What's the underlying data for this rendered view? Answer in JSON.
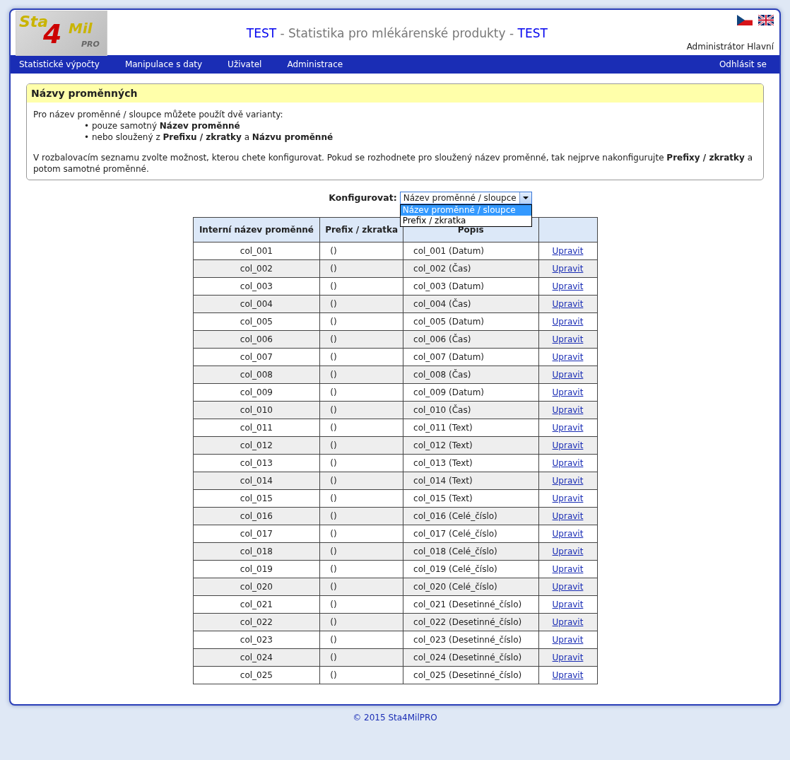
{
  "header": {
    "logo": {
      "parts": [
        "Sta",
        "4",
        "Mil",
        "PRO"
      ]
    },
    "title": {
      "prefix": "TEST",
      "main": " - Statistika pro mlékárenské produkty - ",
      "suffix": "TEST"
    },
    "languages": [
      {
        "kind": "czech"
      },
      {
        "kind": "english"
      }
    ],
    "user": "Administrátor Hlavní"
  },
  "nav": {
    "items": [
      "Statistické výpočty",
      "Manipulace s daty",
      "Uživatel",
      "Administrace"
    ],
    "logout": "Odhlásit se"
  },
  "info_box": {
    "title": "Názvy proměnných",
    "intro": "Pro název proměnné / sloupce můžete použít dvě varianty:",
    "bullets": [
      "• pouze samotný **Název proměnné**",
      "• nebo sloužený z **Prefixu / zkratky** a **Názvu proměnné**"
    ],
    "note": "V rozbalovacím seznamu zvolte možnost, kterou chete konfigurovat. Pokud se rozhodnete pro sloužený název proměnné, tak nejprve nakonfigurujte **Prefixy / zkratky** a potom samotné proměnné."
  },
  "configure": {
    "label": "Konfigurovat:",
    "value": "Název proměnné / sloupce",
    "expanded": true,
    "options": [
      {
        "label": "Název proměnné / sloupce",
        "selected": true
      },
      {
        "label": "Prefix / zkratka",
        "selected": false
      }
    ]
  },
  "table": {
    "columns": [
      "Interní název proměnné",
      "Prefix / zkratka",
      "Popis"
    ],
    "rows": [
      {
        "name": "col_001",
        "prefix": "()",
        "description": "col_001 (Datum)",
        "action": "Upravit"
      },
      {
        "name": "col_002",
        "prefix": "()",
        "description": "col_002 (Čas)",
        "action": "Upravit"
      },
      {
        "name": "col_003",
        "prefix": "()",
        "description": "col_003 (Datum)",
        "action": "Upravit"
      },
      {
        "name": "col_004",
        "prefix": "()",
        "description": "col_004 (Čas)",
        "action": "Upravit"
      },
      {
        "name": "col_005",
        "prefix": "()",
        "description": "col_005 (Datum)",
        "action": "Upravit"
      },
      {
        "name": "col_006",
        "prefix": "()",
        "description": "col_006 (Čas)",
        "action": "Upravit"
      },
      {
        "name": "col_007",
        "prefix": "()",
        "description": "col_007 (Datum)",
        "action": "Upravit"
      },
      {
        "name": "col_008",
        "prefix": "()",
        "description": "col_008 (Čas)",
        "action": "Upravit"
      },
      {
        "name": "col_009",
        "prefix": "()",
        "description": "col_009 (Datum)",
        "action": "Upravit"
      },
      {
        "name": "col_010",
        "prefix": "()",
        "description": "col_010 (Čas)",
        "action": "Upravit"
      },
      {
        "name": "col_011",
        "prefix": "()",
        "description": "col_011 (Text)",
        "action": "Upravit"
      },
      {
        "name": "col_012",
        "prefix": "()",
        "description": "col_012 (Text)",
        "action": "Upravit"
      },
      {
        "name": "col_013",
        "prefix": "()",
        "description": "col_013 (Text)",
        "action": "Upravit"
      },
      {
        "name": "col_014",
        "prefix": "()",
        "description": "col_014 (Text)",
        "action": "Upravit"
      },
      {
        "name": "col_015",
        "prefix": "()",
        "description": "col_015 (Text)",
        "action": "Upravit"
      },
      {
        "name": "col_016",
        "prefix": "()",
        "description": "col_016 (Celé_číslo)",
        "action": "Upravit"
      },
      {
        "name": "col_017",
        "prefix": "()",
        "description": "col_017 (Celé_číslo)",
        "action": "Upravit"
      },
      {
        "name": "col_018",
        "prefix": "()",
        "description": "col_018 (Celé_číslo)",
        "action": "Upravit"
      },
      {
        "name": "col_019",
        "prefix": "()",
        "description": "col_019 (Celé_číslo)",
        "action": "Upravit"
      },
      {
        "name": "col_020",
        "prefix": "()",
        "description": "col_020 (Celé_číslo)",
        "action": "Upravit"
      },
      {
        "name": "col_021",
        "prefix": "()",
        "description": "col_021 (Desetinné_číslo)",
        "action": "Upravit"
      },
      {
        "name": "col_022",
        "prefix": "()",
        "description": "col_022 (Desetinné_číslo)",
        "action": "Upravit"
      },
      {
        "name": "col_023",
        "prefix": "()",
        "description": "col_023 (Desetinné_číslo)",
        "action": "Upravit"
      },
      {
        "name": "col_024",
        "prefix": "()",
        "description": "col_024 (Desetinné_číslo)",
        "action": "Upravit"
      },
      {
        "name": "col_025",
        "prefix": "()",
        "description": "col_025 (Desetinné_číslo)",
        "action": "Upravit"
      }
    ]
  },
  "footer": "© 2015 Sta4MilPRO"
}
